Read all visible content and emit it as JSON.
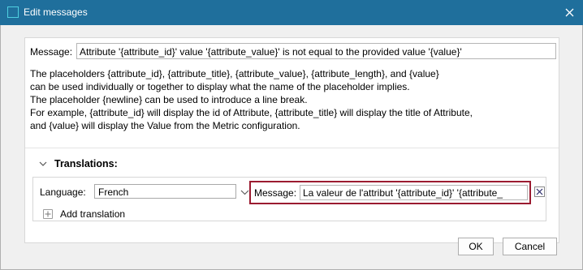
{
  "window": {
    "title": "Edit messages"
  },
  "message": {
    "label": "Message:",
    "value": "Attribute '{attribute_id}' value '{attribute_value}' is not equal to the provided value '{value}'"
  },
  "help_lines": [
    "The placeholders {attribute_id}, {attribute_title}, {attribute_value}, {attribute_length}, and {value}",
    "can be used individually or together to display what the name of the placeholder implies.",
    "The placeholder {newline} can be used to introduce a line break.",
    "For example, {attribute_id} will display the id of Attribute, {attribute_title} will display the title of Attribute,",
    "and {value} will display the Value from the Metric configuration."
  ],
  "translations": {
    "header": "Translations:",
    "language_label": "Language:",
    "language_value": "French",
    "message_label": "Message:",
    "message_value": "La valeur de l'attribut '{attribute_id}' '{attribute_",
    "add_label": "Add translation"
  },
  "buttons": {
    "ok": "OK",
    "cancel": "Cancel"
  },
  "colors": {
    "titlebar": "#1f6f9c",
    "highlight_border": "#9b1b30"
  }
}
